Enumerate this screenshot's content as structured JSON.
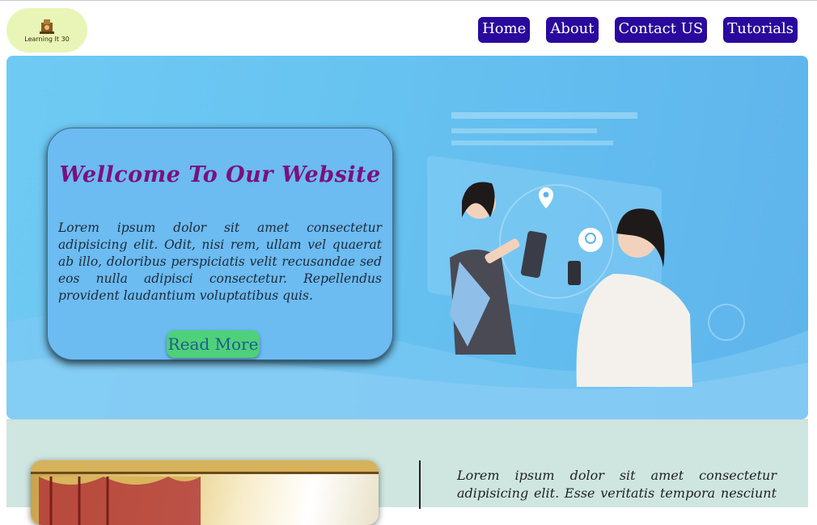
{
  "header": {
    "logo_text": "Learning It 30",
    "nav": [
      "Home",
      "About",
      "Contact US",
      "Tutorials"
    ]
  },
  "hero": {
    "title": "Wellcome To Our Website",
    "body": "Lorem ipsum dolor sit amet consectetur adipisicing elit. Odit, nisi rem, ullam vel quaerat ab illo, doloribus perspiciatis velit recusandae sed eos nulla adipisci consectetur. Repellendus provident laudantium voluptatibus quis.",
    "cta_label": "Read More"
  },
  "section2": {
    "text": "Lorem ipsum dolor sit amet consectetur adipisicing elit. Esse veritatis tempora nesciunt"
  },
  "colors": {
    "nav_bg": "#2a0a9c",
    "title": "#7a117d",
    "cta_bg": "#4fd07b",
    "hero_bg": "#66c2f0"
  }
}
